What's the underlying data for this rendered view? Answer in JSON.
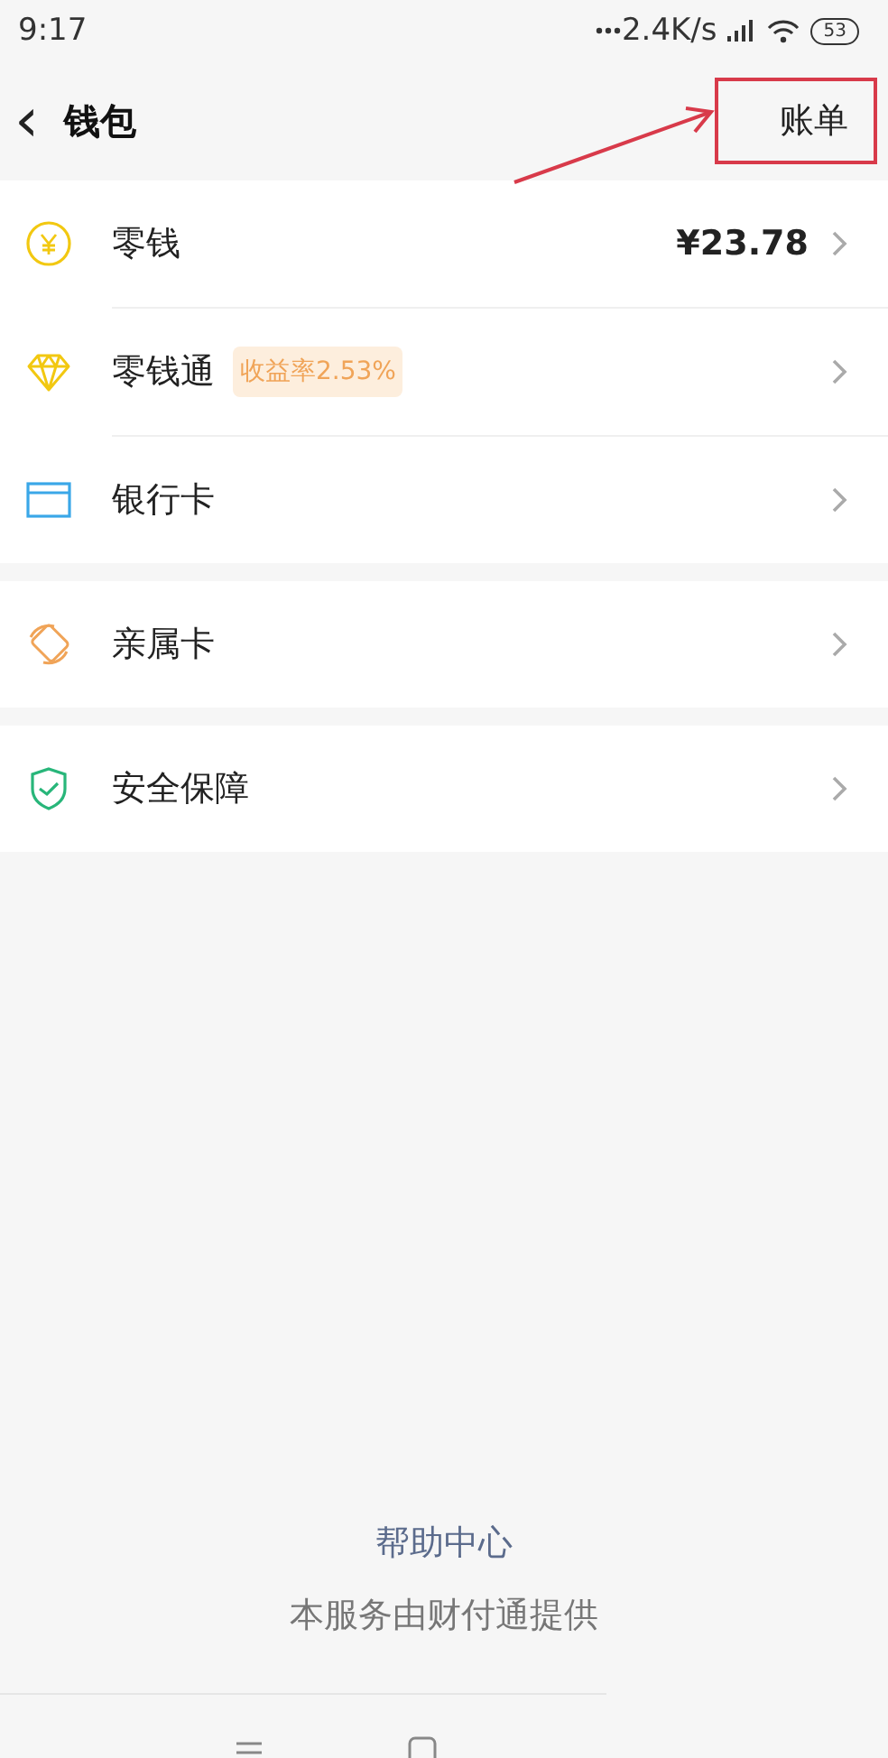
{
  "status_bar": {
    "time": "9:17",
    "speed": "2.4K/s",
    "battery": "53"
  },
  "header": {
    "back_icon": "‹",
    "title": "钱包",
    "bill_button": {
      "label": "账单",
      "highlighted": true
    }
  },
  "groups": [
    {
      "items": [
        {
          "kind": "coin",
          "label": "零钱",
          "value": "¥23.78"
        },
        {
          "kind": "diamond",
          "label": "零钱通",
          "badge": "收益率2.53%"
        },
        {
          "kind": "card",
          "label": "银行卡"
        }
      ]
    },
    {
      "items": [
        {
          "kind": "family",
          "label": "亲属卡"
        }
      ]
    },
    {
      "items": [
        {
          "kind": "shield",
          "label": "安全保障"
        }
      ]
    }
  ],
  "footer": {
    "help_link": "帮助中心",
    "provider_note": "本服务由财付通提供"
  }
}
